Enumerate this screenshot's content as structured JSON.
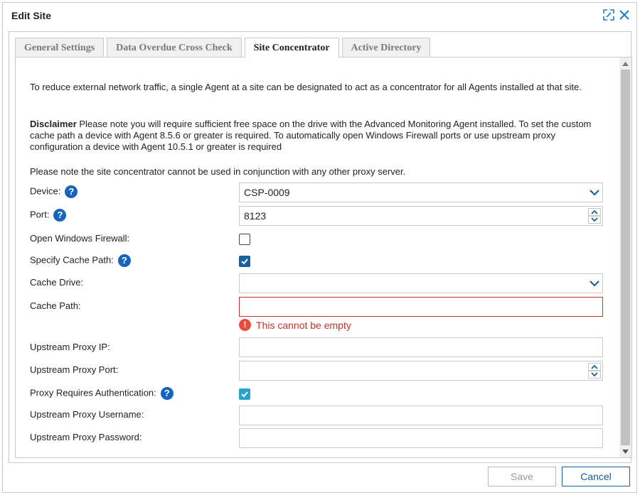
{
  "dialog": {
    "title": "Edit Site"
  },
  "tabs": [
    {
      "label": "General Settings"
    },
    {
      "label": "Data Overdue Cross Check"
    },
    {
      "label": "Site Concentrator"
    },
    {
      "label": "Active Directory"
    }
  ],
  "content": {
    "intro": "To reduce external network traffic, a single Agent at a site can be designated to act as a concentrator for all Agents installed at that site.",
    "disclaimer_label": "Disclaimer",
    "disclaimer_text": " Please note you will require sufficient free space on the drive with the Advanced Monitoring Agent installed. To set the custom cache path a device with Agent 8.5.6 or greater is required. To automatically open Windows Firewall ports or use upstream proxy configuration a device with Agent 10.5.1 or greater is required",
    "note": "Please note the site concentrator cannot be used in conjunction with any other proxy server."
  },
  "form": {
    "device_label": "Device:",
    "device_value": "CSP-0009",
    "port_label": "Port:",
    "port_value": "8123",
    "firewall_label": "Open Windows Firewall:",
    "cache_path_toggle_label": "Specify Cache Path:",
    "cache_drive_label": "Cache Drive:",
    "cache_drive_value": "",
    "cache_path_label": "Cache Path:",
    "cache_path_value": "",
    "cache_path_error": "This cannot be empty",
    "proxy_ip_label": "Upstream Proxy IP:",
    "proxy_ip_value": "",
    "proxy_port_label": "Upstream Proxy Port:",
    "proxy_port_value": "",
    "proxy_auth_label": "Proxy Requires Authentication:",
    "proxy_username_label": "Upstream Proxy Username:",
    "proxy_username_value": "",
    "proxy_password_label": "Upstream Proxy Password:",
    "proxy_password_value": ""
  },
  "footer": {
    "save_label": "Save",
    "cancel_label": "Cancel"
  },
  "colors": {
    "accent": "#1a5f9e",
    "error": "#c9302c",
    "help": "#1565c0"
  },
  "icons": [
    "expand-icon",
    "close-icon",
    "help-icon",
    "chevron-down-icon",
    "spin-up-icon",
    "spin-down-icon",
    "error-icon",
    "check-icon"
  ]
}
